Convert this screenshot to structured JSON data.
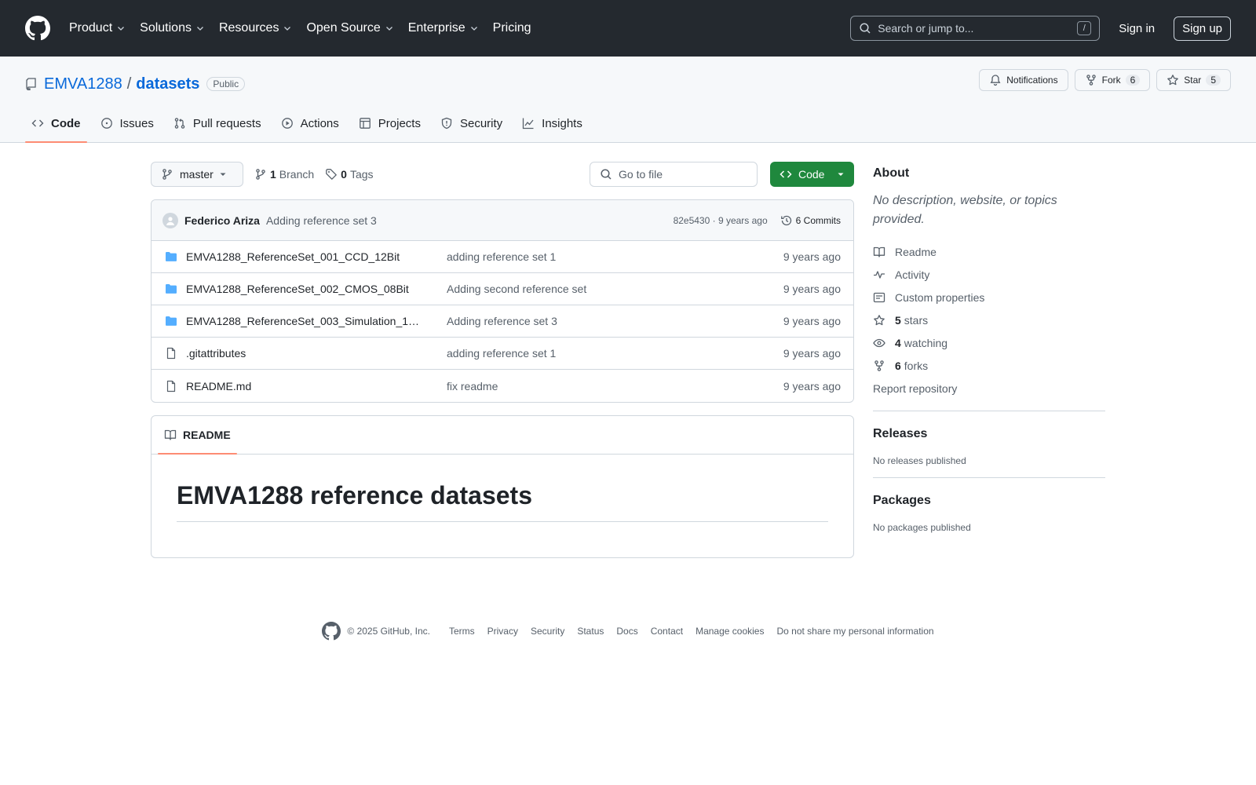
{
  "header": {
    "nav": [
      "Product",
      "Solutions",
      "Resources",
      "Open Source",
      "Enterprise",
      "Pricing"
    ],
    "search_placeholder": "Search or jump to...",
    "search_shortcut": "/",
    "sign_in": "Sign in",
    "sign_up": "Sign up"
  },
  "repo": {
    "owner": "EMVA1288",
    "separator": "/",
    "name": "datasets",
    "visibility": "Public",
    "notifications_label": "Notifications",
    "fork_label": "Fork",
    "fork_count": "6",
    "star_label": "Star",
    "star_count": "5"
  },
  "tabs": [
    "Code",
    "Issues",
    "Pull requests",
    "Actions",
    "Projects",
    "Security",
    "Insights"
  ],
  "toolbar": {
    "branch": "master",
    "branch_count": "1",
    "branch_label": "Branch",
    "tag_count": "0",
    "tag_label": "Tags",
    "goto_placeholder": "Go to file",
    "code_button": "Code"
  },
  "latest_commit": {
    "author": "Federico Ariza",
    "message": "Adding reference set 3",
    "meta": "82e5430 · 9 years ago",
    "commits": "6 Commits"
  },
  "files": [
    {
      "type": "folder",
      "name": "EMVA1288_ReferenceSet_001_CCD_12Bit",
      "message": "adding reference set 1",
      "date": "9 years ago"
    },
    {
      "type": "folder",
      "name": "EMVA1288_ReferenceSet_002_CMOS_08Bit",
      "message": "Adding second reference set",
      "date": "9 years ago"
    },
    {
      "type": "folder",
      "name": "EMVA1288_ReferenceSet_003_Simulation_1…",
      "message": "Adding reference set 3",
      "date": "9 years ago"
    },
    {
      "type": "file",
      "name": ".gitattributes",
      "message": "adding reference set 1",
      "date": "9 years ago"
    },
    {
      "type": "file",
      "name": "README.md",
      "message": "fix readme",
      "date": "9 years ago"
    }
  ],
  "readme": {
    "tab": "README",
    "heading": "EMVA1288 reference datasets"
  },
  "about": {
    "title": "About",
    "description": "No description, website, or topics provided.",
    "readme": "Readme",
    "activity": "Activity",
    "custom_properties": "Custom properties",
    "stars_count": "5",
    "stars_label": "stars",
    "watching_count": "4",
    "watching_label": "watching",
    "forks_count": "6",
    "forks_label": "forks",
    "report": "Report repository"
  },
  "releases": {
    "title": "Releases",
    "note": "No releases published"
  },
  "packages": {
    "title": "Packages",
    "note": "No packages published"
  },
  "footer": {
    "copyright": "© 2025 GitHub, Inc.",
    "links": [
      "Terms",
      "Privacy",
      "Security",
      "Status",
      "Docs",
      "Contact",
      "Manage cookies",
      "Do not share my personal information"
    ]
  },
  "colors": {
    "header_bg": "#24292f",
    "link": "#0969da",
    "code_button": "#1f883d",
    "active_tab_underline": "#fd8c73",
    "folder_icon": "#54aeff"
  }
}
